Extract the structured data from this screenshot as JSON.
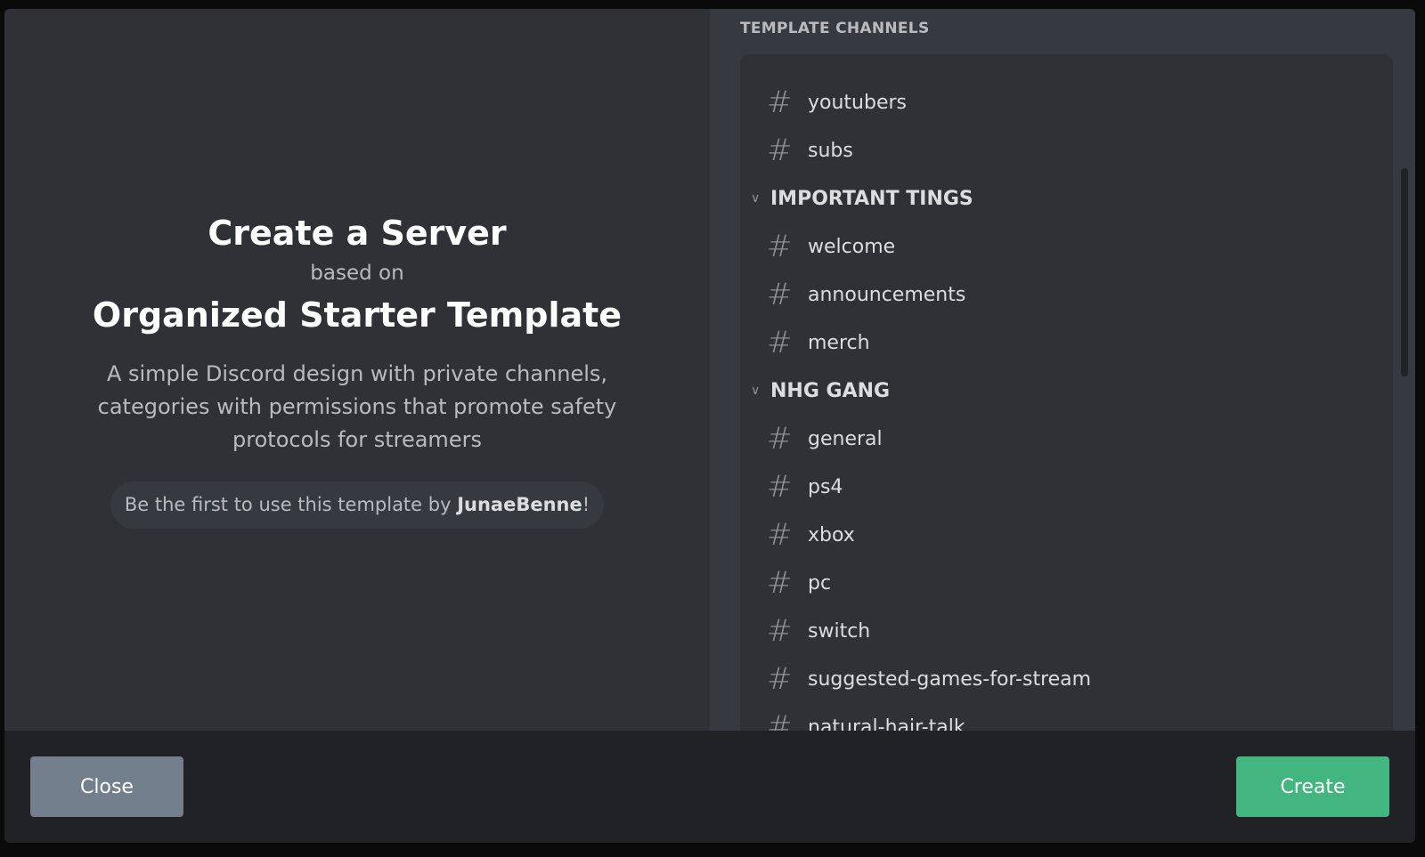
{
  "left": {
    "title": "Create a Server",
    "based_on": "based on",
    "template_name": "Organized Starter Template",
    "description": "A simple Discord design with private channels, categories with permissions that promote safety protocols for streamers",
    "first_use_prefix": "Be the first to use this template by ",
    "author": "JunaeBenne",
    "first_use_suffix": "!"
  },
  "right": {
    "section_title": "TEMPLATE CHANNELS",
    "items": [
      {
        "type": "channel",
        "name": "youtubers"
      },
      {
        "type": "channel",
        "name": "subs"
      },
      {
        "type": "category",
        "name": "IMPORTANT TINGS"
      },
      {
        "type": "channel",
        "name": "welcome"
      },
      {
        "type": "channel",
        "name": "announcements"
      },
      {
        "type": "channel",
        "name": "merch"
      },
      {
        "type": "category",
        "name": "NHG GANG"
      },
      {
        "type": "channel",
        "name": "general"
      },
      {
        "type": "channel",
        "name": "ps4"
      },
      {
        "type": "channel",
        "name": "xbox"
      },
      {
        "type": "channel",
        "name": "pc"
      },
      {
        "type": "channel",
        "name": "switch"
      },
      {
        "type": "channel",
        "name": "suggested-games-for-stream"
      },
      {
        "type": "channel",
        "name": "natural-hair-talk"
      }
    ]
  },
  "footer": {
    "close_label": "Close",
    "create_label": "Create"
  },
  "colors": {
    "create": "#43b581",
    "close": "#747f8d"
  }
}
